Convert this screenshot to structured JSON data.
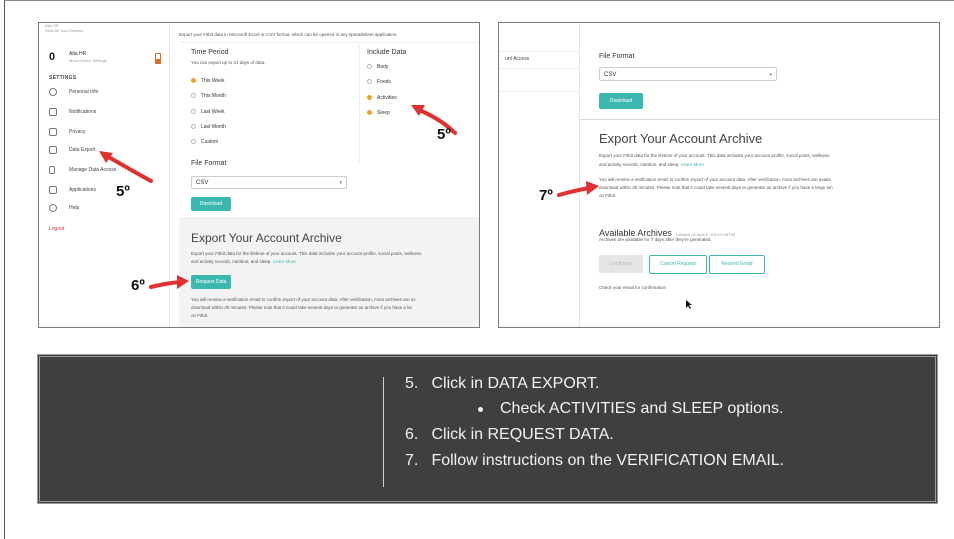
{
  "screenshot1": {
    "sidebar": {
      "top_lines": [
        "Alta HR",
        "View All Your Devices"
      ],
      "device": {
        "count": "0",
        "name": "Alta HR",
        "sub": "More Device Settings"
      },
      "settings_heading": "SETTINGS",
      "items": [
        {
          "label": "Personal Info",
          "icon": "person-icon"
        },
        {
          "label": "Notifications",
          "icon": "bell-icon"
        },
        {
          "label": "Privacy",
          "icon": "lock-icon"
        },
        {
          "label": "Data Export",
          "icon": "export-icon"
        },
        {
          "label": "Manage Data Access",
          "icon": "phone-icon"
        },
        {
          "label": "Applications",
          "icon": "apps-icon"
        },
        {
          "label": "Help",
          "icon": "gear-icon"
        }
      ],
      "logout": "Logout"
    },
    "main": {
      "intro": "Export your Fitbit data in Microsoft Excel or CSV format, which can be opened in any spreadsheet application.",
      "time_period": {
        "heading": "Time Period",
        "note": "You can export up to 31 days of data.",
        "options": [
          "This Week",
          "This Month",
          "Last Week",
          "Last Month",
          "Custom"
        ],
        "selected": "This Week"
      },
      "include_data": {
        "heading": "Include Data",
        "options": [
          "Body",
          "Foods",
          "Activities",
          "Sleep"
        ],
        "checked": [
          "Activities",
          "Sleep"
        ]
      },
      "file_format": {
        "heading": "File Format",
        "value": "CSV"
      },
      "download": "Download",
      "archive": {
        "heading": "Export Your Account Archive",
        "desc": "Export your Fitbit data for the lifetime of your account. This data includes your account profile, social posts, wellness",
        "desc2": "and activity records, nutrition, and sleep.",
        "learn_more": "Learn More",
        "request": "Request Data",
        "note1": "You will receive a verification email to confirm export of your account data. After verification, most archives are av",
        "note2": "download within 30 minutes. Please note that it could take several days to generate an archive if you have a lar",
        "note3": "on Fitbit."
      }
    },
    "annotations": [
      "5º",
      "5º",
      "6º"
    ]
  },
  "screenshot2": {
    "sidebar_item": "unt Access",
    "file_format": {
      "heading": "File Format",
      "value": "CSV"
    },
    "download": "Download",
    "archive": {
      "heading": "Export Your Account Archive",
      "desc": "Export your Fitbit data for the lifetime of your account. This data includes your account profile, social posts, wellness",
      "desc2": "and activity records, nutrition, and sleep.",
      "learn_more": "Learn More",
      "note1": "You will receive a verification email to confirm export of your account data. After verification, most archives are availa",
      "note2": "download within 30 minutes. Please note that it could take several days to generate an archive if you have a large am",
      "note3": "on Fitbit."
    },
    "available": {
      "heading": "Available Archives",
      "initiated": "initiated on April 8, 2019 9:58 PM",
      "note": "Archives are available for 7 days after they're generated.",
      "buttons": [
        "Confirmed",
        "Cancel Request",
        "Resend Email"
      ],
      "check": "Check your email for confirmation"
    },
    "annotation": "7º"
  },
  "instructions": {
    "items": [
      {
        "num": "5.",
        "text": "Click in DATA EXPORT."
      },
      {
        "num": "",
        "text": "Check ACTIVITIES and SLEEP options."
      },
      {
        "num": "6.",
        "text": "Click in REQUEST DATA."
      },
      {
        "num": "7.",
        "text": "Follow instructions on the VERIFICATION EMAIL."
      }
    ]
  },
  "colors": {
    "accent_teal": "#3db8b0",
    "radio_orange": "#f0a220",
    "arrow_red": "#e03030",
    "instr_bg": "#3f3f3f"
  }
}
